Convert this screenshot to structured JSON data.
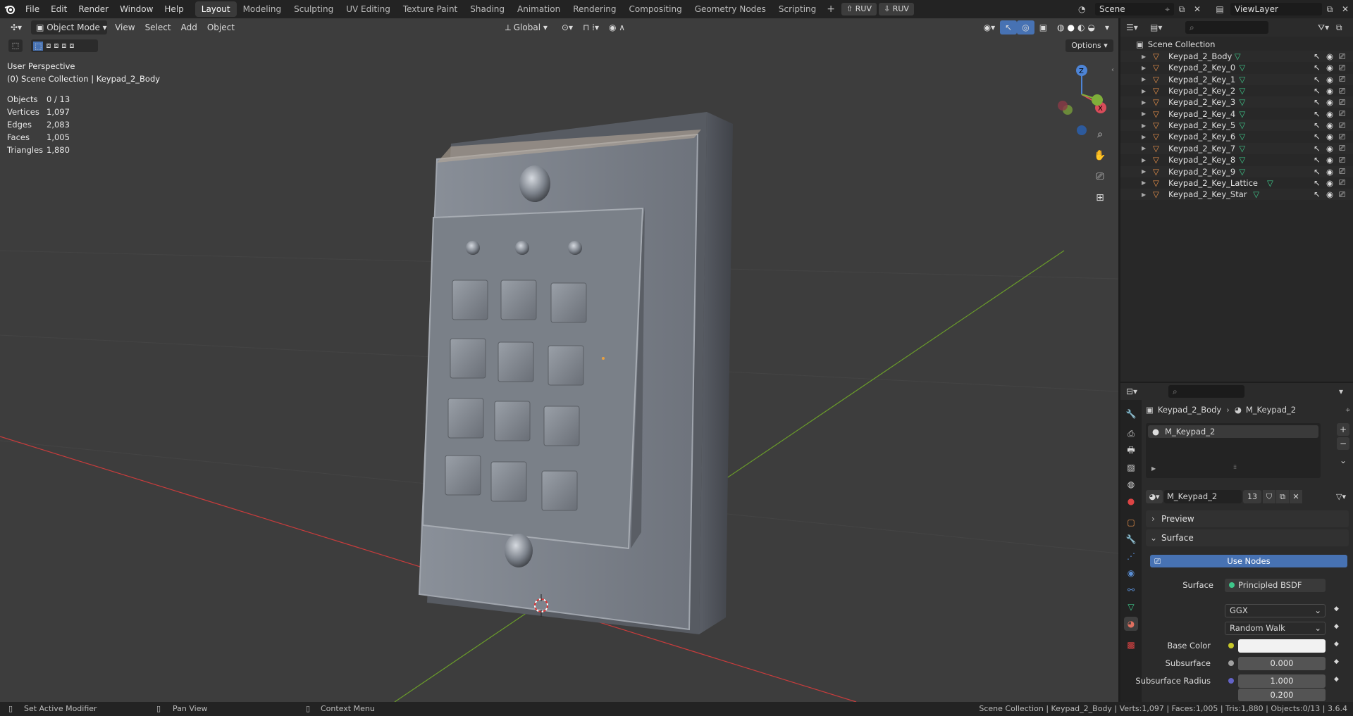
{
  "topbar": {
    "menus": [
      "File",
      "Edit",
      "Render",
      "Window",
      "Help"
    ],
    "workspaces": [
      "Layout",
      "Modeling",
      "Sculpting",
      "UV Editing",
      "Texture Paint",
      "Shading",
      "Animation",
      "Rendering",
      "Compositing",
      "Geometry Nodes",
      "Scripting"
    ],
    "active_workspace": "Layout",
    "add_tab": "+",
    "ruv_export": "RUV",
    "ruv_import": "RUV",
    "scene_name": "Scene",
    "view_layer": "ViewLayer"
  },
  "viewport_header": {
    "mode": "Object Mode",
    "menus": [
      "View",
      "Select",
      "Add",
      "Object"
    ],
    "orientation": "Global",
    "options": "Options"
  },
  "overlay": {
    "perspective": "User Perspective",
    "collection_info": "(0) Scene Collection | Keypad_2_Body",
    "stats": [
      {
        "label": "Objects",
        "value": "0 / 13"
      },
      {
        "label": "Vertices",
        "value": "1,097"
      },
      {
        "label": "Edges",
        "value": "2,083"
      },
      {
        "label": "Faces",
        "value": "1,005"
      },
      {
        "label": "Triangles",
        "value": "1,880"
      }
    ]
  },
  "gizmo": {
    "z": "Z",
    "x": "X",
    "y": "Y"
  },
  "outliner": {
    "root": "Scene Collection",
    "items": [
      "Keypad_2_Body",
      "Keypad_2_Key_0",
      "Keypad_2_Key_1",
      "Keypad_2_Key_2",
      "Keypad_2_Key_3",
      "Keypad_2_Key_4",
      "Keypad_2_Key_5",
      "Keypad_2_Key_6",
      "Keypad_2_Key_7",
      "Keypad_2_Key_8",
      "Keypad_2_Key_9",
      "Keypad_2_Key_Lattice",
      "Keypad_2_Key_Star"
    ]
  },
  "properties": {
    "breadcrumb_object": "Keypad_2_Body",
    "breadcrumb_material": "M_Keypad_2",
    "slot_name": "M_Keypad_2",
    "material_name": "M_Keypad_2",
    "user_count": "13",
    "preview_label": "Preview",
    "surface_panel": "Surface",
    "use_nodes": "Use Nodes",
    "surface_label": "Surface",
    "surface_value": "Principled BSDF",
    "distribution": "GGX",
    "subsurface_method": "Random Walk",
    "base_color_label": "Base Color",
    "subsurface_label": "Subsurface",
    "subsurface_value": "0.000",
    "subsurface_radius_label": "Subsurface Radius",
    "subsurface_radius_1": "1.000",
    "subsurface_radius_2": "0.200"
  },
  "statusbar": {
    "left1": "Set Active Modifier",
    "left2": "Pan View",
    "left3": "Context Menu",
    "right": "Scene Collection | Keypad_2_Body | Verts:1,097 | Faces:1,005 | Tris:1,880 | Objects:0/13 | 3.6.4"
  },
  "colors": {
    "accent_blue": "#4772b3",
    "object_orange": "#e8914a",
    "mesh_green": "#3ec78a",
    "axis_red": "#c83c3c",
    "axis_green": "#6a9c2a"
  }
}
